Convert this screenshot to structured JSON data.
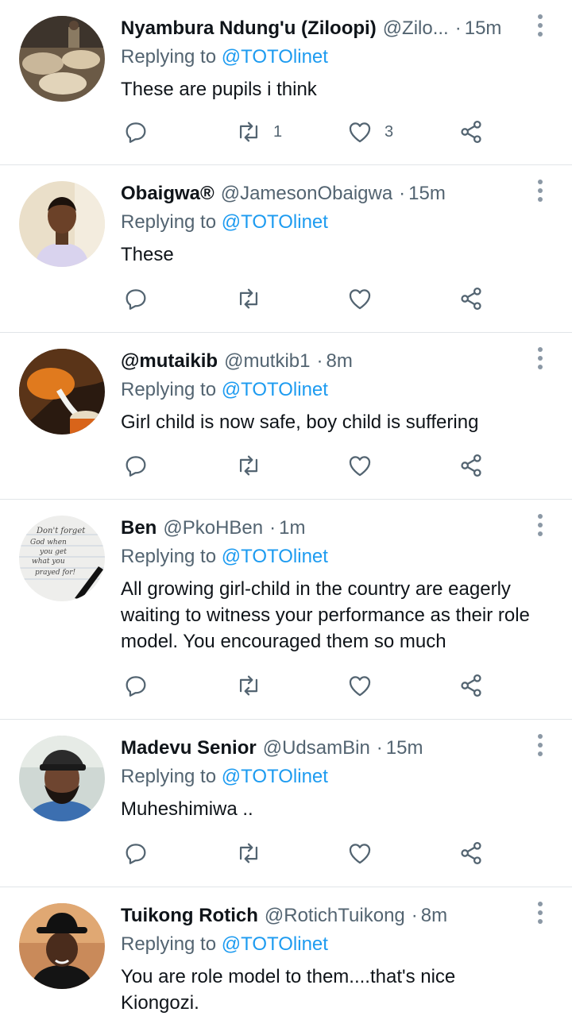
{
  "reply_prefix": "Replying to",
  "tweets": [
    {
      "name": "Nyambura Ndung'u (Ziloopi)",
      "handle": "@Zilo...",
      "dot": "·",
      "time": "15m",
      "reply_to": "@TOTOlinet",
      "text": "These are pupils i think",
      "retweets": "1",
      "likes": "3",
      "avatar": "market-baskets"
    },
    {
      "name": "Obaigwa®",
      "handle": "@JamesonObaigwa",
      "dot": "·",
      "time": "15m",
      "reply_to": "@TOTOlinet",
      "text": "These",
      "retweets": "",
      "likes": "",
      "avatar": "man-portrait"
    },
    {
      "name": "@mutaikib",
      "handle": "@mutkib1",
      "dot": "·",
      "time": "8m",
      "reply_to": "@TOTOlinet",
      "text": "Girl child is now safe, boy child is suffering",
      "retweets": "",
      "likes": "",
      "avatar": "pouring-milk"
    },
    {
      "name": "Ben",
      "handle": "@PkoHBen",
      "dot": "·",
      "time": "1m",
      "reply_to": "@TOTOlinet",
      "text": "All growing girl-child in the country are eagerly waiting to witness your performance as their role model. You encouraged them so much",
      "retweets": "",
      "likes": "",
      "avatar": "handwritten-note",
      "avatar_text": [
        "Don't forget",
        "God when",
        "you get",
        "what you",
        "prayed for!"
      ]
    },
    {
      "name": "Madevu Senior",
      "handle": "@UdsamBin",
      "dot": "·",
      "time": "15m",
      "reply_to": "@TOTOlinet",
      "text": "Muheshimiwa ..",
      "retweets": "",
      "likes": "",
      "avatar": "man-cap"
    },
    {
      "name": "Tuikong Rotich",
      "handle": "@RotichTuikong",
      "dot": "·",
      "time": "8m",
      "reply_to": "@TOTOlinet",
      "text": "You are role model to them....that's nice Kiongozi.",
      "retweets": "",
      "likes": "",
      "avatar": "man-hat-cartoon"
    }
  ],
  "colors": {
    "link": "#1d9bf0",
    "secondary": "#536471",
    "divider": "#e1e5e8"
  },
  "action_icons": [
    "reply-icon",
    "retweet-icon",
    "like-icon",
    "share-icon"
  ]
}
